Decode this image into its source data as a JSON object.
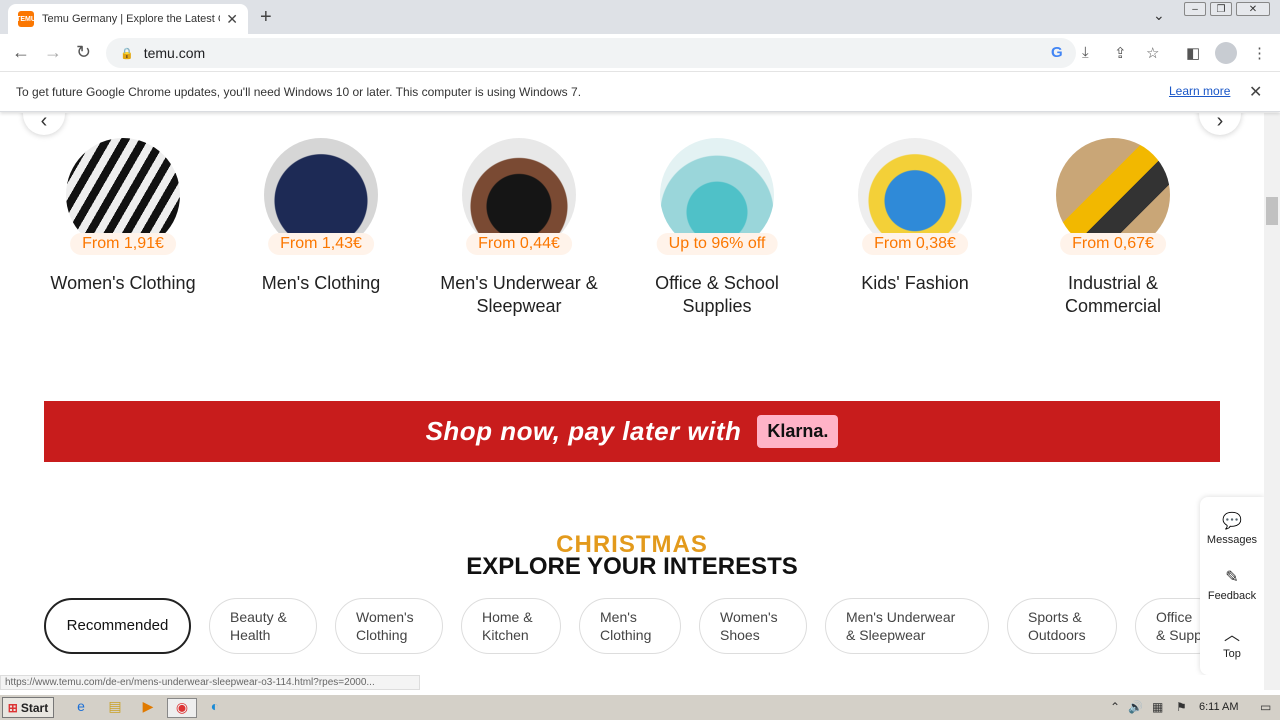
{
  "browser": {
    "tab_title": "Temu Germany | Explore the Latest C",
    "favicon_text": "TEMU",
    "url": "temu.com",
    "new_tab_label": "+",
    "close_tab_label": "✕"
  },
  "infobar": {
    "message": "To get future Google Chrome updates, you'll need Windows 10 or later. This computer is using Windows 7.",
    "learn_more": "Learn more",
    "close_label": "✕"
  },
  "categories": [
    {
      "price": "From 1,91€",
      "name": "Women's Clothing"
    },
    {
      "price": "From 1,43€",
      "name": "Men's Clothing"
    },
    {
      "price": "From 0,44€",
      "name": "Men's Underwear & Sleepwear"
    },
    {
      "price": "Up to 96% off",
      "name": "Office & School Supplies"
    },
    {
      "price": "From 0,38€",
      "name": "Kids' Fashion"
    },
    {
      "price": "From 0,67€",
      "name": "Industrial & Commercial"
    }
  ],
  "banner": {
    "text": "Shop now, pay later with",
    "klarna": "Klarna."
  },
  "section": {
    "christmas": "CHRISTMAS",
    "title": "EXPLORE YOUR INTERESTS"
  },
  "pills": [
    "Recommended",
    "Beauty & Health",
    "Women's Clothing",
    "Home & Kitchen",
    "Men's Clothing",
    "Women's Shoes",
    "Men's Underwear & Sleepwear",
    "Sports & Outdoors",
    "Office & Supp"
  ],
  "side_panel": {
    "messages": "Messages",
    "feedback": "Feedback",
    "top": "Top"
  },
  "status_url": "https://www.temu.com/de-en/mens-underwear-sleepwear-o3-114.html?rpes=2000...",
  "taskbar": {
    "start": "Start",
    "clock": "6:11 AM"
  },
  "colors": {
    "accent": "#fb7701",
    "banner": "#c81c1c",
    "klarna": "#ffb3c7"
  }
}
